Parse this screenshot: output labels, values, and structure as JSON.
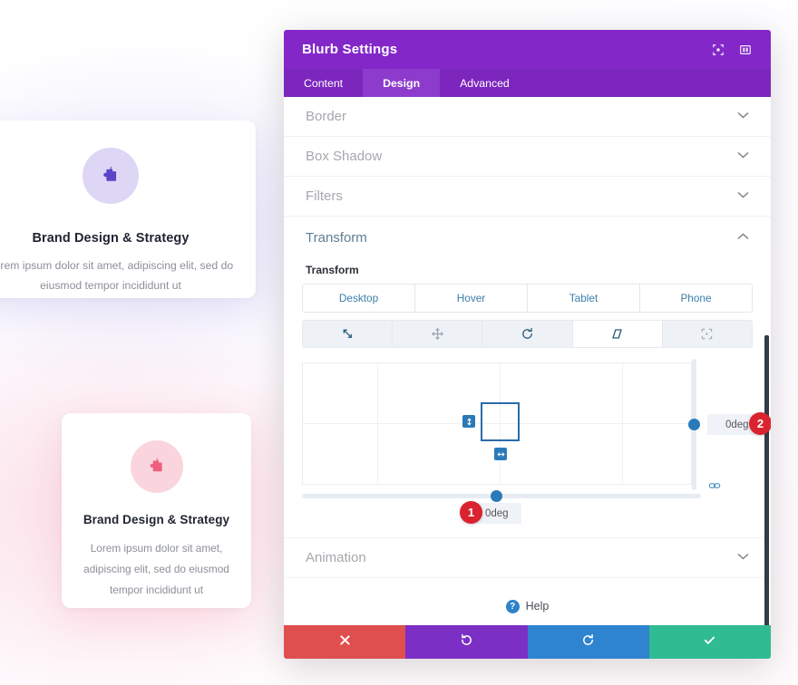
{
  "background": {
    "cards": [
      {
        "icon": "puzzle-piece-icon",
        "title": "Brand Design & Strategy",
        "body": "Lorem ipsum dolor sit amet, adipiscing elit, sed do eiusmod tempor incididunt ut",
        "icon_color": "#5b46c9",
        "icon_bg": "#ddd6f5"
      },
      {
        "icon": "puzzle-piece-icon",
        "title": "Brand Design & Strategy",
        "body": "Lorem ipsum dolor sit amet, adipiscing elit, sed do eiusmod tempor incididunt ut",
        "icon_color": "#ef5e7e",
        "icon_bg": "#fbd5dd"
      }
    ]
  },
  "modal": {
    "title": "Blurb Settings",
    "header_icons": [
      {
        "name": "fullscreen-icon",
        "label": "Expand"
      },
      {
        "name": "layout-columns-icon",
        "label": "Change layout"
      }
    ],
    "tabs": [
      {
        "label": "Content",
        "active": false
      },
      {
        "label": "Design",
        "active": true
      },
      {
        "label": "Advanced",
        "active": false
      }
    ],
    "accordions": [
      {
        "label": "Border",
        "open": false
      },
      {
        "label": "Box Shadow",
        "open": false
      },
      {
        "label": "Filters",
        "open": false
      },
      {
        "label": "Transform",
        "open": true
      },
      {
        "label": "Animation",
        "open": false
      }
    ],
    "transform": {
      "field_label": "Transform",
      "device_tabs": [
        {
          "label": "Desktop",
          "active": false
        },
        {
          "label": "Hover",
          "active": false
        },
        {
          "label": "Tablet",
          "active": false
        },
        {
          "label": "Phone",
          "active": false
        }
      ],
      "mode_tabs": [
        {
          "name": "scale-icon",
          "label": "Scale",
          "active": false
        },
        {
          "name": "move-icon",
          "label": "Translate",
          "active": false
        },
        {
          "name": "rotate-icon",
          "label": "Rotate",
          "active": false
        },
        {
          "name": "skew-icon",
          "label": "Skew",
          "active": true
        },
        {
          "name": "transform-origin-icon",
          "label": "Origin",
          "active": false
        }
      ],
      "skew_x_value": "0deg",
      "skew_y_value": "0deg",
      "link_icon": "link-chain-icon",
      "handles": {
        "vertical": "skew-vertical-handle",
        "horizontal": "skew-horizontal-handle"
      },
      "badges": [
        {
          "number": "1",
          "target": "skew-x-input"
        },
        {
          "number": "2",
          "target": "skew-y-input"
        }
      ]
    },
    "help": {
      "icon": "question-mark-icon",
      "label": "Help"
    },
    "footer_buttons": [
      {
        "name": "cancel-button",
        "icon": "close-x-icon",
        "color": "#e04f4f"
      },
      {
        "name": "undo-button",
        "icon": "undo-arrow-icon",
        "color": "#7b2fc4"
      },
      {
        "name": "redo-button",
        "icon": "redo-arrow-icon",
        "color": "#2e84ce"
      },
      {
        "name": "save-button",
        "icon": "checkmark-icon",
        "color": "#30bb93"
      }
    ],
    "colors": {
      "header": "#8327c9",
      "tabbar": "#7c26bd",
      "accent_blue": "#2a7ab9",
      "badge_red": "#d9232e"
    }
  }
}
